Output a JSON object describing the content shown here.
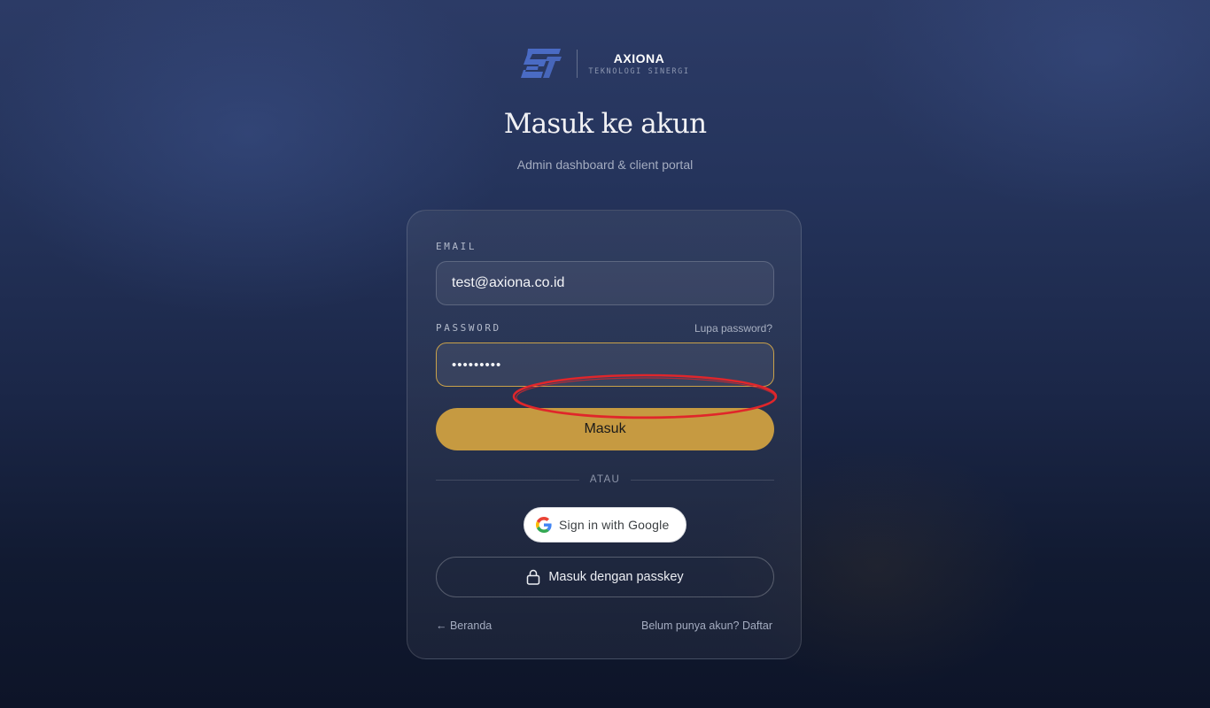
{
  "brand": {
    "logo_icon": "axiona-st-logo-icon",
    "name": "AXIONA",
    "tagline": "TEKNOLOGI SINERGI"
  },
  "header": {
    "title": "Masuk ke akun",
    "subtitle": "Admin dashboard & client portal"
  },
  "form": {
    "email_label": "EMAIL",
    "email_value": "test@axiona.co.id",
    "password_label": "PASSWORD",
    "forgot_link": "Lupa password?",
    "password_masked": "•••••••••",
    "submit_label": "Masuk",
    "divider_text": "ATAU",
    "google_label": "Sign in with Google",
    "google_icon": "google-g-icon",
    "passkey_label": "Masuk dengan passkey",
    "passkey_icon": "lock-icon"
  },
  "footer": {
    "home_link": "← Beranda",
    "signup_link": "Belum punya akun? Daftar"
  },
  "colors": {
    "accent": "#c69a41",
    "focus_border": "#c9a14a",
    "annotation": "#e0262b"
  }
}
